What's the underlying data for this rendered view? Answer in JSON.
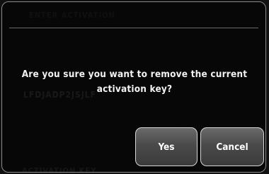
{
  "dialog": {
    "background_text_top": "ENTER ACTIVATION",
    "background_text_middle": "LFDJADP2JSJLF",
    "background_text_bottom": "ACTIVATION KEY",
    "message": "Are you sure you want to remove the current activation key?",
    "buttons": {
      "yes_label": "Yes",
      "cancel_label": "Cancel"
    }
  },
  "colors": {
    "background": "#070707",
    "border": "#8a8a8a",
    "text": "#f2f2f2",
    "button_border": "#d6d6d6",
    "button_fill": "#4a4a4a"
  }
}
